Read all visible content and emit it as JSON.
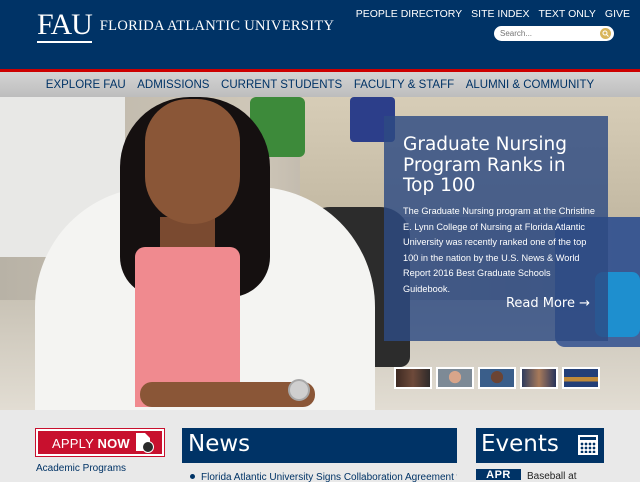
{
  "header": {
    "logo_mark": "FAU",
    "logo_text": "FLORIDA ATLANTIC UNIVERSITY",
    "utility_links": [
      "PEOPLE DIRECTORY",
      "SITE INDEX",
      "TEXT ONLY",
      "GIVE"
    ],
    "search_placeholder": "Search..."
  },
  "nav": {
    "items": [
      "EXPLORE FAU",
      "ADMISSIONS",
      "CURRENT STUDENTS",
      "FACULTY & STAFF",
      "ALUMNI & COMMUNITY"
    ]
  },
  "hero": {
    "headline": "Graduate Nursing Program Ranks in Top 100",
    "body": "The Graduate Nursing program at the Christine E. Lynn College of Nursing at Florida Atlantic University was recently ranked one of the top 100 in the nation by the U.S. News & World Report 2016 Best Graduate Schools Guidebook.",
    "read_more": "Read More →"
  },
  "sidebar": {
    "apply_prefix": "APPLY ",
    "apply_bold": "NOW",
    "academic_link": "Academic Programs"
  },
  "news": {
    "title": "News",
    "first_item": "Florida Atlantic University Signs Collaboration Agreement with"
  },
  "events": {
    "title": "Events",
    "first_month": "APR",
    "first_item": "Baseball at"
  },
  "colors": {
    "brand_blue": "#003366",
    "brand_red": "#cc0000",
    "apply_red": "#c8102e"
  }
}
